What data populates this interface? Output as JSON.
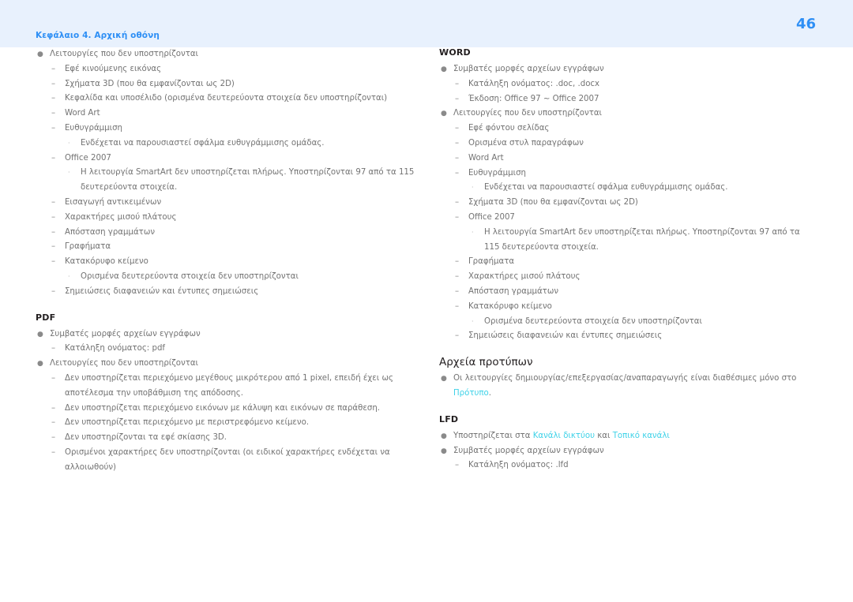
{
  "header": {
    "chapter": "Κεφάλαιο 4. Αρχική οθόνη",
    "page_number": "46",
    "band_color": "#e8f1fd",
    "accent_color": "#2e8ff5"
  },
  "theme": {
    "link_color": "#3ed2e8",
    "body_text_color": "#737373",
    "heading_color": "#231f20"
  },
  "left_column": {
    "items": [
      {
        "level": 1,
        "text": "Λειτουργίες που δεν υποστηρίζονται"
      },
      {
        "level": 2,
        "text": "Εφέ κινούμενης εικόνας"
      },
      {
        "level": 2,
        "text": "Σχήματα 3D (που θα εμφανίζονται ως 2D)"
      },
      {
        "level": 2,
        "text": "Κεφαλίδα και υποσέλιδο (ορισμένα δευτερεύοντα στοιχεία δεν υποστηρίζονται)"
      },
      {
        "level": 2,
        "text": "Word Art"
      },
      {
        "level": 2,
        "text": "Ευθυγράμμιση"
      },
      {
        "level": 3,
        "text": "Ενδέχεται να παρουσιαστεί σφάλμα ευθυγράμμισης ομάδας."
      },
      {
        "level": 2,
        "text": "Office 2007"
      },
      {
        "level": 3,
        "text": "Η λειτουργία SmartArt δεν υποστηρίζεται πλήρως. Υποστηρίζονται 97 από τα 115 δευτερεύοντα στοιχεία."
      },
      {
        "level": 2,
        "text": "Εισαγωγή αντικειμένων"
      },
      {
        "level": 2,
        "text": "Χαρακτήρες μισού πλάτους"
      },
      {
        "level": 2,
        "text": "Απόσταση γραμμάτων"
      },
      {
        "level": 2,
        "text": "Γραφήματα"
      },
      {
        "level": 2,
        "text": "Κατακόρυφο κείμενο"
      },
      {
        "level": 3,
        "text": "Ορισμένα δευτερεύοντα στοιχεία δεν υποστηρίζονται"
      },
      {
        "level": 2,
        "text": "Σημειώσεις διαφανειών και έντυπες σημειώσεις"
      }
    ],
    "pdf_heading": "PDF",
    "pdf_items": [
      {
        "level": 1,
        "text": "Συμβατές μορφές αρχείων εγγράφων"
      },
      {
        "level": 2,
        "text": "Κατάληξη ονόματος: pdf"
      },
      {
        "level": 1,
        "text": "Λειτουργίες που δεν υποστηρίζονται"
      },
      {
        "level": 2,
        "text": "Δεν υποστηρίζεται περιεχόμενο μεγέθους μικρότερου από 1 pixel, επειδή έχει ως αποτέλεσμα την υποβάθμιση της απόδοσης."
      },
      {
        "level": 2,
        "text": "Δεν υποστηρίζεται περιεχόμενο εικόνων με κάλυψη και εικόνων σε παράθεση."
      },
      {
        "level": 2,
        "text": "Δεν υποστηρίζεται περιεχόμενο με περιστρεφόμενο κείμενο."
      },
      {
        "level": 2,
        "text": "Δεν υποστηρίζονται τα εφέ σκίασης 3D."
      },
      {
        "level": 2,
        "text": "Ορισμένοι χαρακτήρες δεν υποστηρίζονται (οι ειδικοί χαρακτήρες ενδέχεται να αλλοιωθούν)"
      }
    ]
  },
  "right_column": {
    "word_heading": "WORD",
    "word_items": [
      {
        "level": 1,
        "text": "Συμβατές μορφές αρχείων εγγράφων"
      },
      {
        "level": 2,
        "text": "Κατάληξη ονόματος: .doc, .docx"
      },
      {
        "level": 2,
        "text": "Έκδοση: Office 97 ~ Office 2007"
      },
      {
        "level": 1,
        "text": "Λειτουργίες που δεν υποστηρίζονται"
      },
      {
        "level": 2,
        "text": "Εφέ φόντου σελίδας"
      },
      {
        "level": 2,
        "text": "Ορισμένα στυλ παραγράφων"
      },
      {
        "level": 2,
        "text": "Word Art"
      },
      {
        "level": 2,
        "text": "Ευθυγράμμιση"
      },
      {
        "level": 3,
        "text": "Ενδέχεται να παρουσιαστεί σφάλμα ευθυγράμμισης ομάδας."
      },
      {
        "level": 2,
        "text": "Σχήματα 3D (που θα εμφανίζονται ως 2D)"
      },
      {
        "level": 2,
        "text": "Office 2007"
      },
      {
        "level": 3,
        "text": "Η λειτουργία SmartArt δεν υποστηρίζεται πλήρως. Υποστηρίζονται 97 από τα 115 δευτερεύοντα στοιχεία."
      },
      {
        "level": 2,
        "text": "Γραφήματα"
      },
      {
        "level": 2,
        "text": "Χαρακτήρες μισού πλάτους"
      },
      {
        "level": 2,
        "text": "Απόσταση γραμμάτων"
      },
      {
        "level": 2,
        "text": "Κατακόρυφο κείμενο"
      },
      {
        "level": 3,
        "text": "Ορισμένα δευτερεύοντα στοιχεία δεν υποστηρίζονται"
      },
      {
        "level": 2,
        "text": "Σημειώσεις διαφανειών και έντυπες σημειώσεις"
      }
    ],
    "templates_heading": "Αρχεία προτύπων",
    "templates_item": {
      "prefix": "Οι λειτουργίες δημιουργίας/επεξεργασίας/αναπαραγωγής είναι διαθέσιμες μόνο στο ",
      "link": "Πρότυπο",
      "suffix": "."
    },
    "lfd_heading": "LFD",
    "lfd_first_item": {
      "prefix": "Υποστηρίζεται στα ",
      "link1": "Κανάλι δικτύου",
      "middle": " και ",
      "link2": "Τοπικό κανάλι"
    },
    "lfd_items": [
      {
        "level": 1,
        "text": "Συμβατές μορφές αρχείων εγγράφων"
      },
      {
        "level": 2,
        "text": "Κατάληξη ονόματος: .lfd"
      }
    ]
  },
  "markers": {
    "bullet": "●",
    "dash": "–",
    "dot": "·"
  }
}
